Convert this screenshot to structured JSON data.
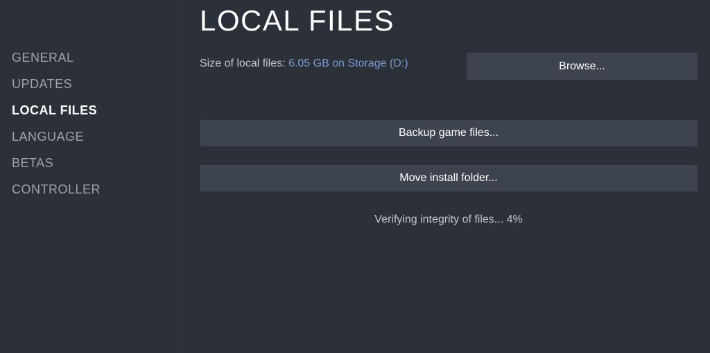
{
  "window": {
    "title": "LOCAL FILES"
  },
  "colors": {
    "background": "#2b3039",
    "button_fill": "#3d4450",
    "link_blue": "#7b9ad4",
    "text_primary": "#ffffff",
    "text_secondary": "#c0c6cf",
    "text_muted": "#9ba3ad"
  },
  "sidebar": {
    "items": [
      {
        "id": "general",
        "label": "GENERAL",
        "active": false
      },
      {
        "id": "updates",
        "label": "UPDATES",
        "active": false
      },
      {
        "id": "local-files",
        "label": "LOCAL FILES",
        "active": true
      },
      {
        "id": "language",
        "label": "LANGUAGE",
        "active": false
      },
      {
        "id": "betas",
        "label": "BETAS",
        "active": false
      },
      {
        "id": "controller",
        "label": "CONTROLLER",
        "active": false
      }
    ]
  },
  "main": {
    "heading": "LOCAL FILES",
    "size_label": "Size of local files:",
    "size_value": "6.05 GB on Storage (D:)",
    "browse_button": "Browse...",
    "backup_button": "Backup game files...",
    "move_button": "Move install folder...",
    "status": "Verifying integrity of files... 4%",
    "status_progress_percent": 4
  }
}
